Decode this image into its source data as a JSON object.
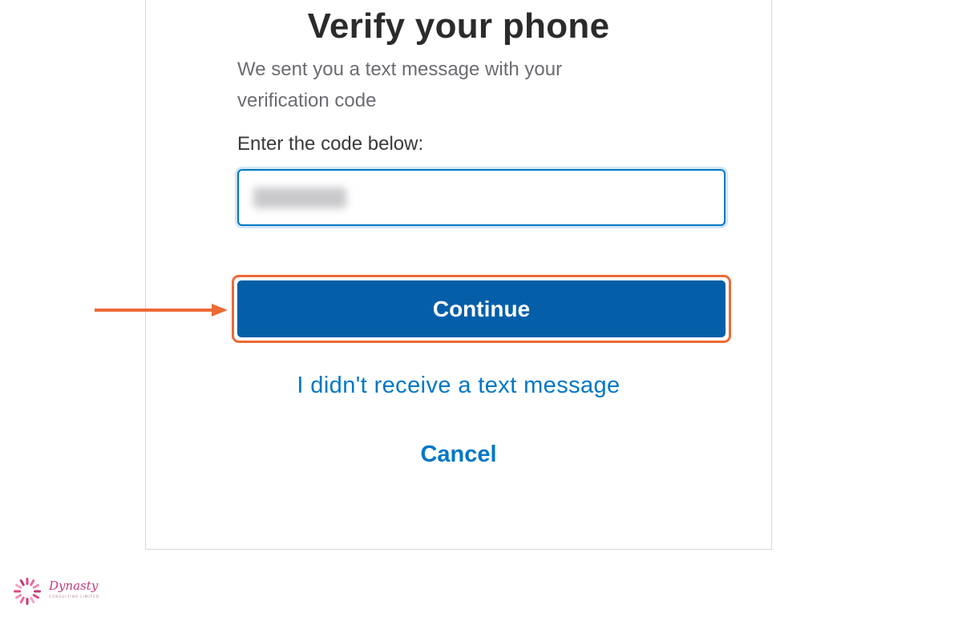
{
  "page": {
    "title": "Verify your phone",
    "subtitle": "We sent you a text message with your verification code",
    "code_label": "Enter the code below:",
    "continue_label": "Continue",
    "no_text_link": "I didn't receive a text message",
    "cancel_label": "Cancel"
  },
  "branding": {
    "logo_text": "Dynasty",
    "logo_subtext": "CONSULTING LIMITED"
  },
  "colors": {
    "primary": "#055fa8",
    "link": "#0077c5",
    "highlight": "#ed6a35",
    "title": "#2b2b2b",
    "logo": "#c23a7a"
  }
}
